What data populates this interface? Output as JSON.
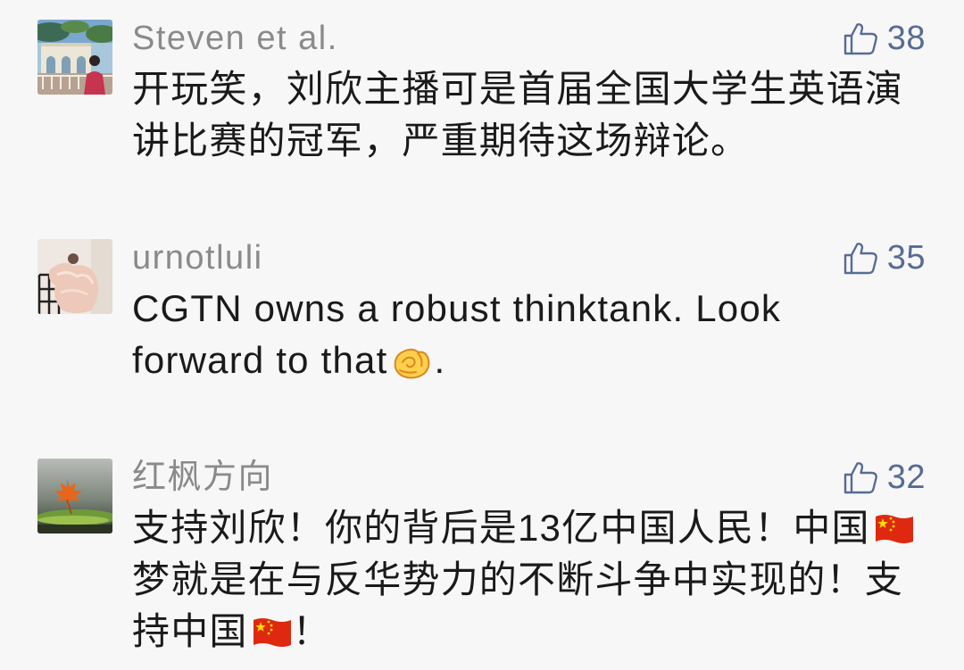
{
  "colors": {
    "background": "#f7f7f7",
    "username": "#8a8a8a",
    "comment_text": "#1a1a1a",
    "like": "#576b95"
  },
  "like_icon": "thumbs-up-icon",
  "comments": [
    {
      "username": "Steven et al.",
      "likes": 38,
      "body": [
        [
          "开玩笑，刘欣主播可是首届全国大学生英语演"
        ],
        [
          "讲比赛的冠军，严重期待这场辩论。"
        ]
      ]
    },
    {
      "username": "urnotluli",
      "likes": 35,
      "body": [
        [
          "CGTN owns a robust thinktank. Look"
        ],
        [
          "forward to that",
          {
            "emoji": "beckon-hand-emoji"
          },
          "."
        ]
      ]
    },
    {
      "username": "红枫方向",
      "likes": 32,
      "body": [
        [
          "支持刘欣！你的背后是13亿中国人民！中国",
          {
            "emoji": "china-flag-emoji"
          }
        ],
        [
          "梦就是在与反华势力的不断斗争中实现的！支"
        ],
        [
          "持中国",
          {
            "emoji": "china-flag-emoji"
          },
          "！"
        ]
      ]
    }
  ]
}
